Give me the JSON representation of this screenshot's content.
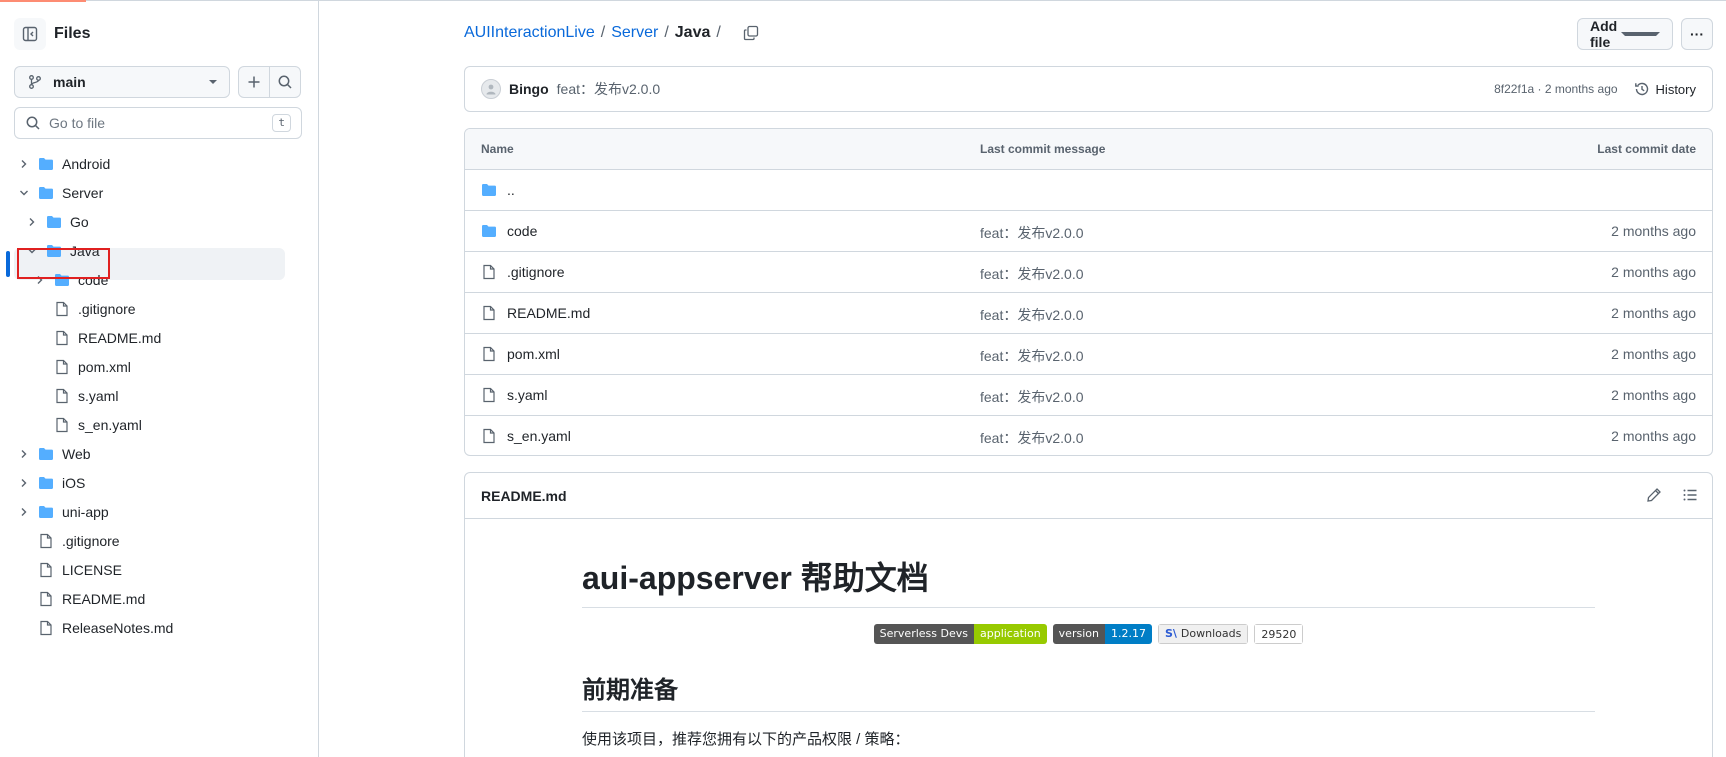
{
  "sidebar": {
    "title": "Files",
    "branch": "main",
    "goto_placeholder": "Go to file",
    "goto_shortcut": "t",
    "tree": [
      {
        "label": "Android",
        "type": "folder",
        "expanded": false
      },
      {
        "label": "Server",
        "type": "folder",
        "expanded": true
      },
      {
        "label": "Go",
        "type": "folder",
        "expanded": false
      },
      {
        "label": "Java",
        "type": "folder",
        "expanded": true,
        "selected": true
      },
      {
        "label": "code",
        "type": "folder",
        "expanded": false
      },
      {
        "label": ".gitignore",
        "type": "file"
      },
      {
        "label": "README.md",
        "type": "file"
      },
      {
        "label": "pom.xml",
        "type": "file"
      },
      {
        "label": "s.yaml",
        "type": "file"
      },
      {
        "label": "s_en.yaml",
        "type": "file"
      },
      {
        "label": "Web",
        "type": "folder",
        "expanded": false
      },
      {
        "label": "iOS",
        "type": "folder",
        "expanded": false
      },
      {
        "label": "uni-app",
        "type": "folder",
        "expanded": false
      },
      {
        "label": ".gitignore",
        "type": "file"
      },
      {
        "label": "LICENSE",
        "type": "file"
      },
      {
        "label": "README.md",
        "type": "file"
      },
      {
        "label": "ReleaseNotes.md",
        "type": "file"
      }
    ]
  },
  "breadcrumb": {
    "repo": "AUIInteractionLive",
    "folder": "Server",
    "current": "Java",
    "sep": "/"
  },
  "toolbar": {
    "add_file": "Add file",
    "more": "···"
  },
  "commit": {
    "author": "Bingo",
    "message": "feat：发布v2.0.0",
    "meta": "8f22f1a · 2 months ago",
    "history": "History"
  },
  "table": {
    "headers": {
      "name": "Name",
      "message": "Last commit message",
      "date": "Last commit date"
    },
    "rows": [
      {
        "name": "..",
        "type": "folder",
        "message": "",
        "date": ""
      },
      {
        "name": "code",
        "type": "folder",
        "message": "feat：发布v2.0.0",
        "date": "2 months ago"
      },
      {
        "name": ".gitignore",
        "type": "file",
        "message": "feat：发布v2.0.0",
        "date": "2 months ago"
      },
      {
        "name": "README.md",
        "type": "file",
        "message": "feat：发布v2.0.0",
        "date": "2 months ago"
      },
      {
        "name": "pom.xml",
        "type": "file",
        "message": "feat：发布v2.0.0",
        "date": "2 months ago"
      },
      {
        "name": "s.yaml",
        "type": "file",
        "message": "feat：发布v2.0.0",
        "date": "2 months ago"
      },
      {
        "name": "s_en.yaml",
        "type": "file",
        "message": "feat：发布v2.0.0",
        "date": "2 months ago"
      }
    ]
  },
  "readme": {
    "title": "README.md",
    "h1": "aui-appserver 帮助文档",
    "badges": {
      "serverless": "Serverless Devs",
      "application": "application",
      "version_label": "version",
      "version_value": "1.2.17",
      "downloads_mark": "S\\",
      "downloads_label": "Downloads",
      "downloads_count": "29520"
    },
    "h2": "前期准备",
    "paragraph": "使用该项目，推荐您拥有以下的产品权限 / 策略："
  },
  "colors": {
    "accent": "#0969da",
    "folder": "#54aeff",
    "highlight_box": "#e02020",
    "badge_green": "#97ca00",
    "badge_blue": "#007ec6"
  }
}
